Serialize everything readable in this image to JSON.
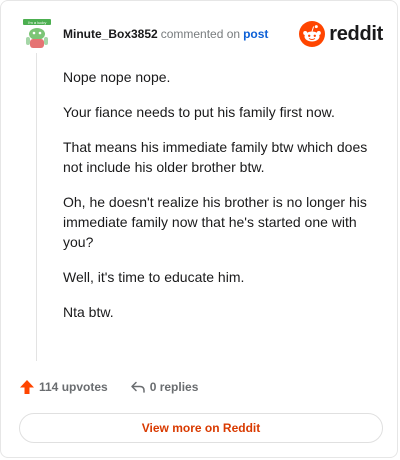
{
  "header": {
    "username": "Minute_Box3852",
    "action_text": "commented on",
    "post_link": "post",
    "brand": "reddit"
  },
  "avatar": {
    "badge_text": "I'm a lucky",
    "icon": "snoo-avatar-icon"
  },
  "comment": {
    "paragraphs": [
      "Nope nope nope.",
      "Your fiance needs to put his family first now.",
      "That means his immediate family btw which does not include his older brother btw.",
      "Oh, he doesn't realize his brother is no longer his immediate family now that he's started one with you?",
      "Well, it's time to educate him.",
      "Nta btw."
    ]
  },
  "actions": {
    "upvotes": "114 upvotes",
    "replies": "0 replies"
  },
  "cta": {
    "label": "View more on Reddit"
  },
  "colors": {
    "accent": "#ff4500",
    "link": "#0b5fd6",
    "cta_text": "#d93a00"
  }
}
